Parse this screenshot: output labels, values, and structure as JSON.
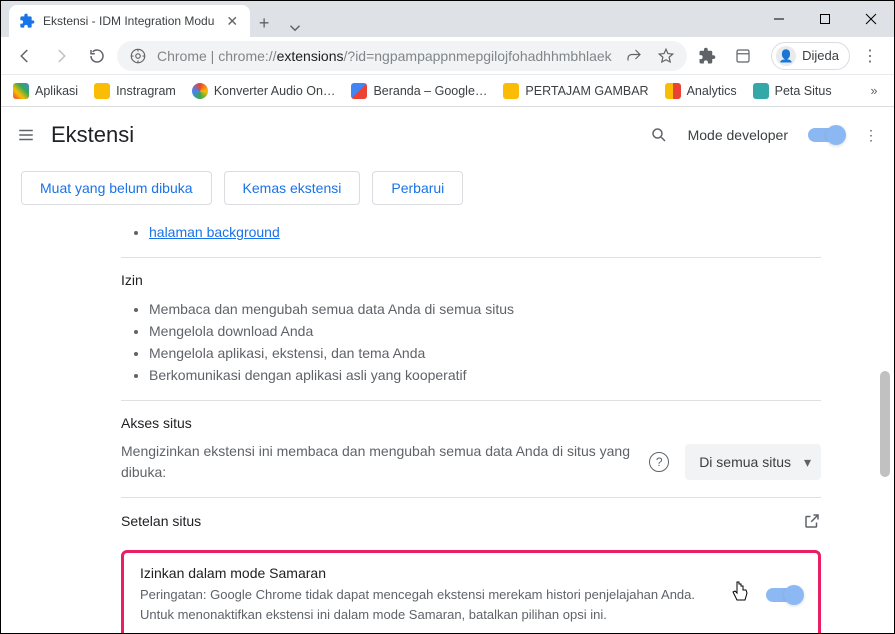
{
  "window": {
    "tab_title": "Ekstensi - IDM Integration Modu"
  },
  "address": {
    "prefix": "Chrome | ",
    "scheme": "chrome://",
    "host": "extensions",
    "rest": "/?id=ngpampappnmepgilojfohadhhmbhlaek"
  },
  "profile_chip": "Dijeda",
  "bookmarks": [
    {
      "label": "Aplikasi"
    },
    {
      "label": "Instragram"
    },
    {
      "label": "Konverter Audio On…"
    },
    {
      "label": "Beranda – Google…"
    },
    {
      "label": "PERTAJAM GAMBAR"
    },
    {
      "label": "Analytics"
    },
    {
      "label": "Peta Situs"
    }
  ],
  "header": {
    "title": "Ekstensi",
    "dev_mode_label": "Mode developer"
  },
  "actions": {
    "load_unpacked": "Muat yang belum dibuka",
    "pack_extension": "Kemas ekstensi",
    "update": "Perbarui"
  },
  "inspect": {
    "bg_link": "halaman background"
  },
  "permissions": {
    "title": "Izin",
    "items": [
      "Membaca dan mengubah semua data Anda di semua situs",
      "Mengelola download Anda",
      "Mengelola aplikasi, ekstensi, dan tema Anda",
      "Berkomunikasi dengan aplikasi asli yang kooperatif"
    ]
  },
  "site_access": {
    "title": "Akses situs",
    "desc": "Mengizinkan ekstensi ini membaca dan mengubah semua data Anda di situs yang dibuka:",
    "dropdown": "Di semua situs"
  },
  "site_settings": {
    "title": "Setelan situs"
  },
  "incognito": {
    "title": "Izinkan dalam mode Samaran",
    "warning": "Peringatan: Google Chrome tidak dapat mencegah ekstensi merekam histori penjelajahan Anda. Untuk menonaktifkan ekstensi ini dalam mode Samaran, batalkan pilihan opsi ini."
  }
}
